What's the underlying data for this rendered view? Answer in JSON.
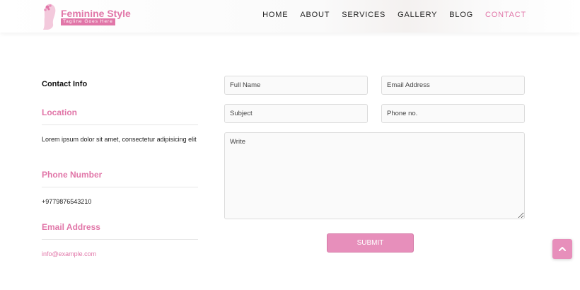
{
  "brand": {
    "name": "Feminine Style",
    "tagline": "Tagline Goes Here"
  },
  "nav": {
    "items": [
      {
        "label": "HOME",
        "active": false
      },
      {
        "label": "ABOUT",
        "active": false
      },
      {
        "label": "SERVICES",
        "active": false
      },
      {
        "label": "GALLERY",
        "active": false
      },
      {
        "label": "BLOG",
        "active": false
      },
      {
        "label": "CONTACT",
        "active": true
      }
    ]
  },
  "contact": {
    "title": "Contact Info",
    "location_heading": "Location",
    "location_text": "Lorem ipsum dolor sit amet, consectetur adipisicing elit",
    "phone_heading": "Phone Number",
    "phone_text": "+9779876543210",
    "email_heading": "Email Address",
    "email_text": "info@example.com"
  },
  "form": {
    "full_name_placeholder": "Full Name",
    "email_placeholder": "Email Address",
    "subject_placeholder": "Subject",
    "phone_placeholder": "Phone no.",
    "message_placeholder": "Write",
    "submit_label": "SUBMIT"
  },
  "icons": {
    "logo": "woman-silhouette-logo-icon",
    "back_to_top": "chevron-up-icon"
  },
  "colors": {
    "accent": "#e176a8",
    "button": "#e78fbb"
  }
}
